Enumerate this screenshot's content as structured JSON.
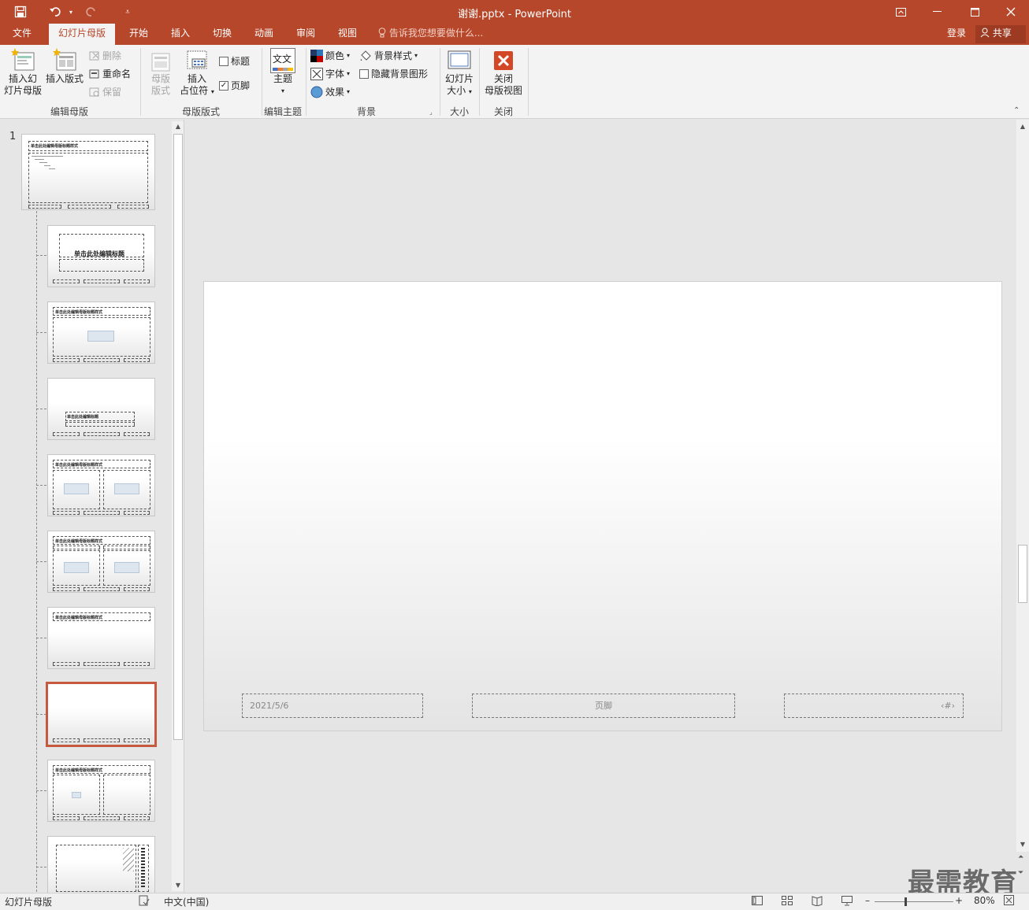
{
  "window": {
    "title": "谢谢.pptx - PowerPoint"
  },
  "tabs": {
    "file": "文件",
    "slide_master": "幻灯片母版",
    "home": "开始",
    "insert": "插入",
    "transitions": "切换",
    "animations": "动画",
    "review": "审阅",
    "view": "视图",
    "tell_me": "告诉我您想要做什么...",
    "sign_in": "登录",
    "share": "共享"
  },
  "ribbon": {
    "insert_master_l1": "插入幻",
    "insert_master_l2": "灯片母版",
    "insert_layout": "插入版式",
    "delete": "删除",
    "rename": "重命名",
    "preserve": "保留",
    "group_edit_master": "编辑母版",
    "master_layout_l1": "母版",
    "master_layout_l2": "版式",
    "insert_placeholder_l1": "插入",
    "insert_placeholder_l2": "占位符",
    "title_check": "标题",
    "footer_check": "页脚",
    "group_master_layout": "母版版式",
    "theme_icon_text": "文文",
    "themes": "主题",
    "group_edit_theme": "编辑主题",
    "colors": "颜色",
    "fonts": "字体",
    "effects": "效果",
    "bg_styles": "背景样式",
    "hide_bg": "隐藏背景图形",
    "group_background": "背景",
    "slide_size_l1": "幻灯片",
    "slide_size_l2": "大小",
    "group_size": "大小",
    "close_l1": "关闭",
    "close_l2": "母版视图",
    "group_close": "关闭"
  },
  "thumbnails": {
    "slide_number": "1",
    "master_title": "单击此处编辑母版标题样式",
    "layout_title": "单击此处编辑标题",
    "layout_subtitle": "单击此处编辑母版副标题样式",
    "layout_title_short": "单击此处编辑母版标题样式",
    "section_title": "单击此处编辑标题"
  },
  "slide": {
    "date": "2021/5/6",
    "footer": "页脚",
    "number_symbol": "‹#›"
  },
  "status": {
    "view_name": "幻灯片母版",
    "language": "中文(中国)",
    "zoom": "80%"
  },
  "watermark": "最需教育",
  "colors": {
    "accent": "#b7472a",
    "selected_border": "#c55a3e"
  }
}
